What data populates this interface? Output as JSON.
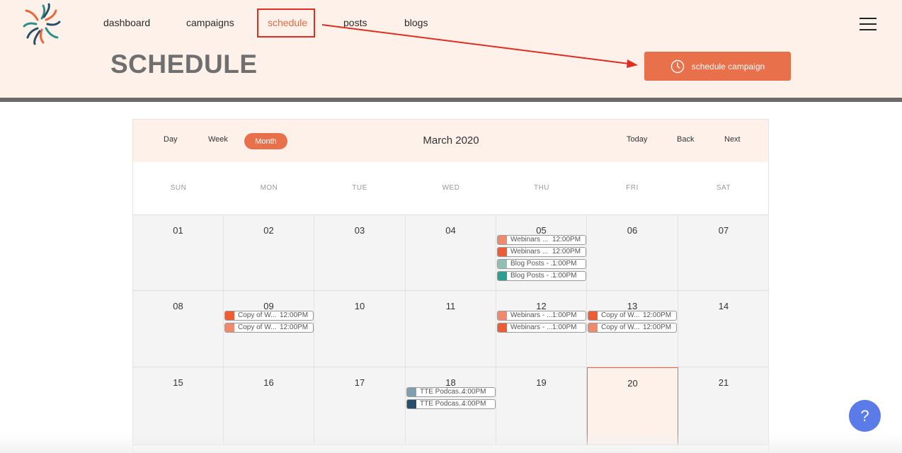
{
  "nav": {
    "links": [
      {
        "label": "dashboard"
      },
      {
        "label": "campaigns"
      },
      {
        "label": "schedule"
      },
      {
        "label": "posts"
      },
      {
        "label": "blogs"
      }
    ],
    "active": "schedule",
    "logo": "starburst-logo",
    "menu_icon": "hamburger-menu-icon"
  },
  "page": {
    "title": "SCHEDULE",
    "schedule_button_label": "schedule campaign",
    "schedule_button_icon": "clock-icon"
  },
  "calendar": {
    "views": [
      "Day",
      "Week",
      "Month"
    ],
    "active_view": "Month",
    "month_title": "March 2020",
    "nav": [
      "Today",
      "Back",
      "Next"
    ],
    "weekdays": [
      "SUN",
      "MON",
      "TUE",
      "WED",
      "THU",
      "FRI",
      "SAT"
    ],
    "weeks": [
      {
        "days": [
          {
            "num": "01",
            "events": []
          },
          {
            "num": "02",
            "events": []
          },
          {
            "num": "03",
            "events": []
          },
          {
            "num": "04",
            "events": []
          },
          {
            "num": "05",
            "events": [
              {
                "title": "Webinars ...",
                "time": "12:00PM",
                "color": "#f08a6e"
              },
              {
                "title": "Webinars ...",
                "time": "12:00PM",
                "color": "#ee5c34"
              },
              {
                "title": "Blog Posts - ...",
                "time": "1:00PM",
                "color": "#8fbfb7"
              },
              {
                "title": "Blog Posts - ...",
                "time": "1:00PM",
                "color": "#2e9e8f"
              }
            ]
          },
          {
            "num": "06",
            "events": []
          },
          {
            "num": "07",
            "events": []
          }
        ]
      },
      {
        "days": [
          {
            "num": "08",
            "events": []
          },
          {
            "num": "09",
            "events": [
              {
                "title": "Copy of W...",
                "time": "12:00PM",
                "color": "#ee5c34"
              },
              {
                "title": "Copy of W...",
                "time": "12:00PM",
                "color": "#f08a6e"
              }
            ]
          },
          {
            "num": "10",
            "events": []
          },
          {
            "num": "11",
            "events": []
          },
          {
            "num": "12",
            "events": [
              {
                "title": "Webinars - ...",
                "time": "1:00PM",
                "color": "#f08a6e"
              },
              {
                "title": "Webinars - ...",
                "time": "1:00PM",
                "color": "#ee5c34"
              }
            ]
          },
          {
            "num": "13",
            "events": [
              {
                "title": "Copy of W...",
                "time": "12:00PM",
                "color": "#ee5c34"
              },
              {
                "title": "Copy of W...",
                "time": "12:00PM",
                "color": "#f08a6e"
              }
            ]
          },
          {
            "num": "14",
            "events": []
          }
        ]
      },
      {
        "days": [
          {
            "num": "15",
            "events": []
          },
          {
            "num": "16",
            "events": []
          },
          {
            "num": "17",
            "events": []
          },
          {
            "num": "18",
            "events": [
              {
                "title": "TTE Podcas...",
                "time": "4:00PM",
                "color": "#7f9fb0"
              },
              {
                "title": "TTE Podcas...",
                "time": "4:00PM",
                "color": "#264f6b"
              }
            ]
          },
          {
            "num": "19",
            "events": []
          },
          {
            "num": "20",
            "events": [],
            "today": true
          },
          {
            "num": "21",
            "events": []
          }
        ]
      }
    ]
  },
  "help": {
    "label": "?"
  },
  "colors": {
    "accent": "#e8704a",
    "annotation_red": "#e02d20",
    "help_blue": "#5b7be8"
  }
}
